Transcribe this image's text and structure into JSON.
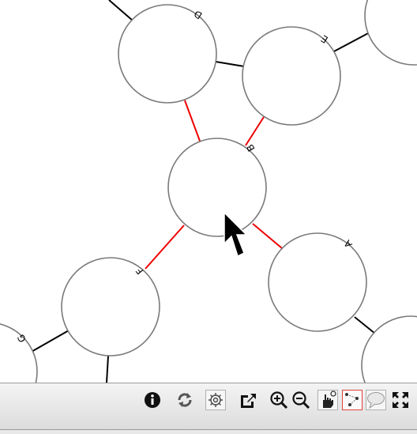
{
  "graph": {
    "nodes": [
      {
        "id": "B",
        "label": "B"
      },
      {
        "id": "D",
        "label": "D"
      },
      {
        "id": "E",
        "label": "E"
      },
      {
        "id": "A",
        "label": "A"
      },
      {
        "id": "F",
        "label": "F"
      },
      {
        "id": "G",
        "label": "G"
      }
    ],
    "edges": [
      {
        "from": "B",
        "to": "D",
        "highlighted": true
      },
      {
        "from": "B",
        "to": "E",
        "highlighted": true
      },
      {
        "from": "B",
        "to": "A",
        "highlighted": true
      },
      {
        "from": "B",
        "to": "F",
        "highlighted": true
      },
      {
        "from": "D",
        "to": "E",
        "highlighted": false
      },
      {
        "from": "F",
        "to": "G",
        "highlighted": false
      }
    ],
    "colors": {
      "highlight_edge": "#ee0000",
      "edge": "#000000",
      "node_stroke": "#7a7a7a"
    }
  },
  "toolbar": {
    "buttons": [
      {
        "name": "info-icon"
      },
      {
        "name": "refresh-icon"
      },
      {
        "name": "settings-icon"
      },
      {
        "name": "export-icon"
      },
      {
        "name": "zoom-in-icon"
      },
      {
        "name": "zoom-out-icon"
      },
      {
        "name": "pan-hand-icon"
      },
      {
        "name": "select-graph-icon",
        "active": true
      },
      {
        "name": "speech-bubble-icon"
      },
      {
        "name": "fullscreen-icon"
      }
    ]
  }
}
